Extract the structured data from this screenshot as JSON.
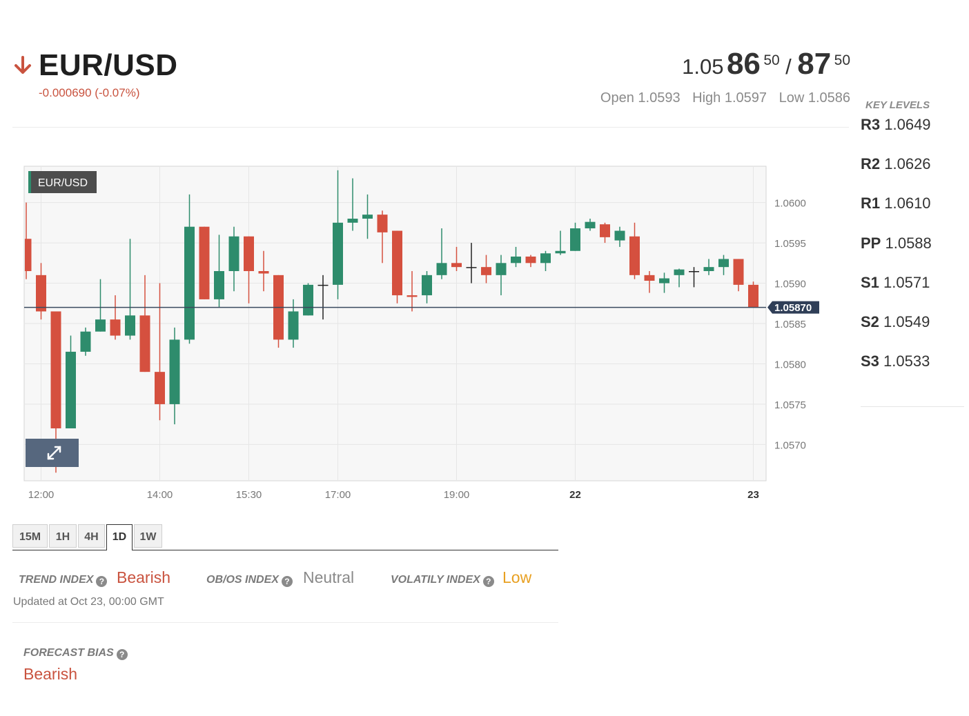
{
  "header": {
    "pair": "EUR/USD",
    "direction_icon": "arrow-down-icon",
    "change": "-0.000690 (-0.07%)"
  },
  "quote": {
    "bid_prefix": "1.05",
    "bid_big": "86",
    "bid_sup": "50",
    "separator": "/",
    "ask_big": "87",
    "ask_sup": "50",
    "open": "Open 1.0593",
    "high": "High 1.0597",
    "low": "Low 1.0586"
  },
  "key_levels": {
    "title": "KEY LEVELS",
    "items": [
      {
        "name": "R3",
        "value": "1.0649"
      },
      {
        "name": "R2",
        "value": "1.0626"
      },
      {
        "name": "R1",
        "value": "1.0610"
      },
      {
        "name": "PP",
        "value": "1.0588"
      },
      {
        "name": "S1",
        "value": "1.0571"
      },
      {
        "name": "S2",
        "value": "1.0549"
      },
      {
        "name": "S3",
        "value": "1.0533"
      }
    ]
  },
  "chart_data": {
    "type": "candlestick",
    "legend": "EUR/USD",
    "current_price": 1.0587,
    "current_price_label": "1.05870",
    "ylim": [
      1.05655,
      1.06045
    ],
    "y_ticks": [
      "1.0570",
      "1.0575",
      "1.0580",
      "1.0585",
      "1.0590",
      "1.0595",
      "1.0600"
    ],
    "y_tick_values": [
      1.057,
      1.0575,
      1.058,
      1.0585,
      1.059,
      1.0595,
      1.06
    ],
    "x_ticks": [
      {
        "label": "12:00",
        "index": 1,
        "bold": false
      },
      {
        "label": "14:00",
        "index": 9,
        "bold": false
      },
      {
        "label": "15:30",
        "index": 15,
        "bold": false
      },
      {
        "label": "17:00",
        "index": 21,
        "bold": false
      },
      {
        "label": "19:00",
        "index": 29,
        "bold": false
      },
      {
        "label": "22",
        "index": 37,
        "bold": true
      },
      {
        "label": "23",
        "index": 49,
        "bold": true
      }
    ],
    "candles": [
      {
        "o": 1.05955,
        "h": 1.06,
        "l": 1.05905,
        "c": 1.05915
      },
      {
        "o": 1.0591,
        "h": 1.05925,
        "l": 1.05855,
        "c": 1.05865
      },
      {
        "o": 1.05865,
        "h": 1.05865,
        "l": 1.05665,
        "c": 1.0572
      },
      {
        "o": 1.0572,
        "h": 1.05835,
        "l": 1.0572,
        "c": 1.05815
      },
      {
        "o": 1.05815,
        "h": 1.05845,
        "l": 1.0581,
        "c": 1.0584
      },
      {
        "o": 1.0584,
        "h": 1.05905,
        "l": 1.0584,
        "c": 1.05855
      },
      {
        "o": 1.05855,
        "h": 1.05885,
        "l": 1.0583,
        "c": 1.05835
      },
      {
        "o": 1.05835,
        "h": 1.05955,
        "l": 1.0583,
        "c": 1.0586
      },
      {
        "o": 1.0586,
        "h": 1.0591,
        "l": 1.0579,
        "c": 1.0579
      },
      {
        "o": 1.0579,
        "h": 1.059,
        "l": 1.0573,
        "c": 1.0575
      },
      {
        "o": 1.0575,
        "h": 1.05845,
        "l": 1.05725,
        "c": 1.0583
      },
      {
        "o": 1.0583,
        "h": 1.0601,
        "l": 1.05825,
        "c": 1.0597
      },
      {
        "o": 1.0597,
        "h": 1.0597,
        "l": 1.0588,
        "c": 1.0588
      },
      {
        "o": 1.0588,
        "h": 1.0596,
        "l": 1.0587,
        "c": 1.05915
      },
      {
        "o": 1.05915,
        "h": 1.0597,
        "l": 1.0589,
        "c": 1.05958
      },
      {
        "o": 1.05958,
        "h": 1.05958,
        "l": 1.05875,
        "c": 1.05915
      },
      {
        "o": 1.05915,
        "h": 1.0594,
        "l": 1.0589,
        "c": 1.05912
      },
      {
        "o": 1.0591,
        "h": 1.0591,
        "l": 1.0582,
        "c": 1.0583
      },
      {
        "o": 1.0583,
        "h": 1.0588,
        "l": 1.0582,
        "c": 1.05865
      },
      {
        "o": 1.0586,
        "h": 1.059,
        "l": 1.0586,
        "c": 1.05898
      },
      {
        "o": 1.05898,
        "h": 1.0591,
        "l": 1.05855,
        "c": 1.05898
      },
      {
        "o": 1.05898,
        "h": 1.0604,
        "l": 1.0588,
        "c": 1.05975
      },
      {
        "o": 1.05975,
        "h": 1.0603,
        "l": 1.05965,
        "c": 1.0598
      },
      {
        "o": 1.0598,
        "h": 1.0601,
        "l": 1.05955,
        "c": 1.05985
      },
      {
        "o": 1.05985,
        "h": 1.0599,
        "l": 1.05925,
        "c": 1.05963
      },
      {
        "o": 1.05965,
        "h": 1.05965,
        "l": 1.05875,
        "c": 1.05885
      },
      {
        "o": 1.05885,
        "h": 1.05915,
        "l": 1.05865,
        "c": 1.05883
      },
      {
        "o": 1.05885,
        "h": 1.05915,
        "l": 1.05875,
        "c": 1.0591
      },
      {
        "o": 1.0591,
        "h": 1.05968,
        "l": 1.05905,
        "c": 1.05925
      },
      {
        "o": 1.05925,
        "h": 1.05945,
        "l": 1.05915,
        "c": 1.0592
      },
      {
        "o": 1.0592,
        "h": 1.0595,
        "l": 1.059,
        "c": 1.0592
      },
      {
        "o": 1.0592,
        "h": 1.05935,
        "l": 1.059,
        "c": 1.0591
      },
      {
        "o": 1.0591,
        "h": 1.05935,
        "l": 1.05885,
        "c": 1.05925
      },
      {
        "o": 1.05925,
        "h": 1.05945,
        "l": 1.0592,
        "c": 1.05933
      },
      {
        "o": 1.05933,
        "h": 1.05935,
        "l": 1.0592,
        "c": 1.05925
      },
      {
        "o": 1.05925,
        "h": 1.0594,
        "l": 1.05915,
        "c": 1.05937
      },
      {
        "o": 1.05937,
        "h": 1.05965,
        "l": 1.05935,
        "c": 1.0594
      },
      {
        "o": 1.0594,
        "h": 1.05975,
        "l": 1.0594,
        "c": 1.05968
      },
      {
        "o": 1.05968,
        "h": 1.0598,
        "l": 1.05965,
        "c": 1.05976
      },
      {
        "o": 1.05973,
        "h": 1.05975,
        "l": 1.0595,
        "c": 1.05957
      },
      {
        "o": 1.05953,
        "h": 1.0597,
        "l": 1.05945,
        "c": 1.05965
      },
      {
        "o": 1.05958,
        "h": 1.05975,
        "l": 1.05905,
        "c": 1.0591
      },
      {
        "o": 1.0591,
        "h": 1.05915,
        "l": 1.05888,
        "c": 1.05903
      },
      {
        "o": 1.059,
        "h": 1.05913,
        "l": 1.05888,
        "c": 1.05906
      },
      {
        "o": 1.0591,
        "h": 1.05918,
        "l": 1.05895,
        "c": 1.05917
      },
      {
        "o": 1.05915,
        "h": 1.0592,
        "l": 1.05895,
        "c": 1.05915
      },
      {
        "o": 1.05915,
        "h": 1.0593,
        "l": 1.0591,
        "c": 1.0592
      },
      {
        "o": 1.0592,
        "h": 1.05935,
        "l": 1.0591,
        "c": 1.0593
      },
      {
        "o": 1.0593,
        "h": 1.0593,
        "l": 1.0589,
        "c": 1.05898
      },
      {
        "o": 1.05898,
        "h": 1.05902,
        "l": 1.0587,
        "c": 1.0587
      }
    ]
  },
  "timeframes": [
    {
      "label": "15M",
      "active": false
    },
    {
      "label": "1H",
      "active": false
    },
    {
      "label": "4H",
      "active": false
    },
    {
      "label": "1D",
      "active": true
    },
    {
      "label": "1W",
      "active": false
    }
  ],
  "indices": {
    "trend": {
      "label": "TREND INDEX",
      "value": "Bearish",
      "color": "#c9533f"
    },
    "obos": {
      "label": "OB/OS INDEX",
      "value": "Neutral",
      "color": "#8a8a8a"
    },
    "volatility": {
      "label": "VOLATILY INDEX",
      "value": "Low",
      "color": "#e8a021"
    },
    "updated": "Updated at Oct 23, 00:00 GMT"
  },
  "forecast": {
    "label": "FORECAST BIAS",
    "value": "Bearish"
  },
  "colors": {
    "up": "#2e8c6c",
    "down": "#d5503f",
    "price_line": "#3a4a5e",
    "price_label_bg": "#2f3e57"
  }
}
